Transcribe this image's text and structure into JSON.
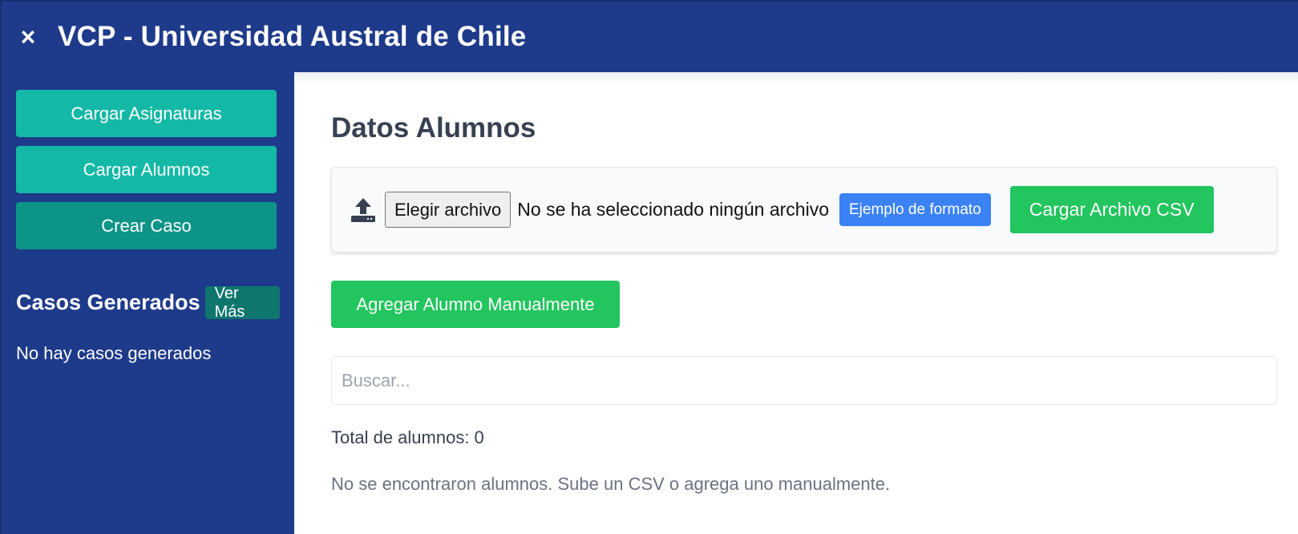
{
  "header": {
    "close_icon": "×",
    "title": "VCP - Universidad Austral de Chile"
  },
  "sidebar": {
    "buttons": [
      {
        "label": "Cargar Asignaturas"
      },
      {
        "label": "Cargar Alumnos"
      },
      {
        "label": "Crear Caso"
      }
    ],
    "cases_title": "Casos Generados",
    "ver_mas_label": "Ver Más",
    "no_cases_text": "No hay casos generados"
  },
  "main": {
    "title": "Datos Alumnos",
    "upload": {
      "icon": "upload-icon",
      "choose_file_label": "Elegir archivo",
      "file_status": "No se ha seleccionado ningún archivo",
      "format_example_label": "Ejemplo de formato",
      "upload_csv_label": "Cargar Archivo CSV"
    },
    "add_student_label": "Agregar Alumno Manualmente",
    "search": {
      "placeholder": "Buscar...",
      "value": ""
    },
    "total_text": "Total de alumnos: 0",
    "empty_text": "No se encontraron alumnos. Sube un CSV o agrega uno manualmente."
  },
  "colors": {
    "primary": "#1e3a8a",
    "teal": "#14b8a6",
    "teal_dark": "#0d9488",
    "green": "#22c55e",
    "blue": "#3b82f6"
  }
}
